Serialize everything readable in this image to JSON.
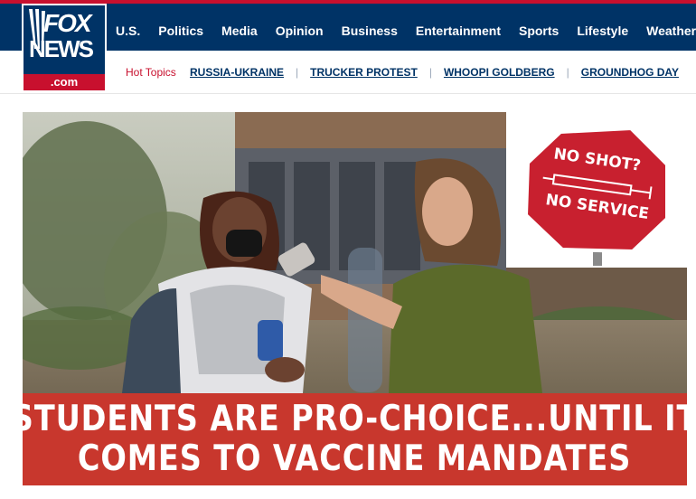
{
  "logo": {
    "line1": "FOX",
    "line2": "NEWS",
    "domain": ".com"
  },
  "nav": {
    "items": [
      "U.S.",
      "Politics",
      "Media",
      "Opinion",
      "Business",
      "Entertainment",
      "Sports",
      "Lifestyle",
      "Weather"
    ]
  },
  "hot_topics": {
    "label": "Hot Topics",
    "items": [
      "RUSSIA-UKRAINE",
      "TRUCKER PROTEST",
      "WHOOPI GOLDBERG",
      "GROUNDHOG DAY"
    ]
  },
  "hero": {
    "sign": {
      "line1": "NO SHOT?",
      "line2": "NO SERVICE"
    },
    "banner": {
      "line1": "STUDENTS ARE PRO-CHOICE...UNTIL IT",
      "line2": "COMES TO VACCINE MANDATES"
    }
  },
  "colors": {
    "nav_bg": "#003366",
    "accent_red": "#c8102e",
    "banner_red": "#c8372d",
    "topic_blue": "#003366"
  }
}
